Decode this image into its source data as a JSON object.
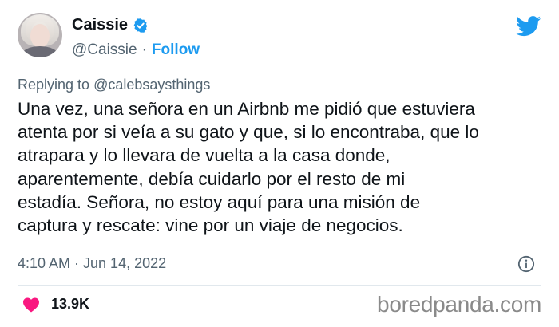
{
  "author": {
    "name": "Caissie",
    "handle": "@Caissie",
    "separator": "·",
    "follow_label": "Follow"
  },
  "reply": {
    "prefix": "Replying to",
    "mention": "@calebsaysthings"
  },
  "tweet": {
    "text": "Una vez, una señora en un Airbnb me pidió que estuviera\natenta por si veía a su gato y que, si lo encontraba, que lo\natrapara y lo llevara de vuelta a la casa donde,\naparentemente, debía cuidarlo por el resto de mi\nestadía. Señora, no estoy aquí para una misión de\ncaptura y rescate: vine por un viaje de negocios.",
    "timestamp": "4:10 AM · Jun 14, 2022"
  },
  "stats": {
    "likes": "13.9K"
  },
  "watermark": "boredpanda.com",
  "colors": {
    "accent": "#1d9bf0",
    "like": "#f91880",
    "secondary_text": "#536471"
  },
  "icons": {
    "verified": "verified-badge-icon",
    "logo": "twitter-bird-icon",
    "info": "info-icon",
    "like": "heart-icon"
  }
}
